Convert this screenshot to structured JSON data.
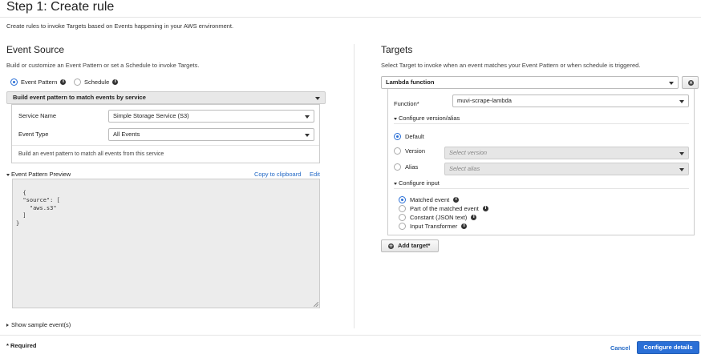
{
  "header": {
    "title": "Step 1: Create rule",
    "subtitle": "Create rules to invoke Targets based on Events happening in your AWS environment."
  },
  "event_source": {
    "heading": "Event Source",
    "description": "Build or customize an Event Pattern or set a Schedule to invoke Targets.",
    "radio_event_pattern": "Event Pattern",
    "radio_schedule": "Schedule",
    "pattern_builder": "Build event pattern to match events by service",
    "service_name_label": "Service Name",
    "service_name_value": "Simple Storage Service (S3)",
    "event_type_label": "Event Type",
    "event_type_value": "All Events",
    "match_note": "Build an event pattern to match all events from this service",
    "preview_label": "Event Pattern Preview",
    "copy_link": "Copy to clipboard",
    "edit_link": "Edit",
    "preview_code": "{\n  \"source\": [\n    \"aws.s3\"\n  ]\n}",
    "show_sample": "Show sample event(s)"
  },
  "targets": {
    "heading": "Targets",
    "description": "Select Target to invoke when an event matches your Event Pattern or when schedule is triggered.",
    "target_type": "Lambda function",
    "function_label": "Function*",
    "function_value": "muvi-scrape-lambda",
    "configure_version": "Configure version/alias",
    "default_label": "Default",
    "version_label": "Version",
    "version_placeholder": "Select version",
    "alias_label": "Alias",
    "alias_placeholder": "Select alias",
    "configure_input": "Configure input",
    "input_options": [
      "Matched event",
      "Part of the matched event",
      "Constant (JSON text)",
      "Input Transformer"
    ],
    "add_target": "Add target*"
  },
  "footer": {
    "required": "* Required",
    "cancel": "Cancel",
    "configure": "Configure details"
  },
  "colors": {
    "accent": "#2a6fd6",
    "link": "#2369c6"
  }
}
